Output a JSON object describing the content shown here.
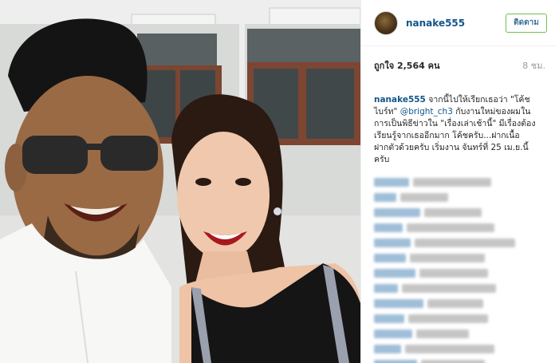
{
  "post": {
    "photo_alt": "photo",
    "author": {
      "username": "nanake555",
      "follow_label": "ติดตาม"
    },
    "likes_label": "ถูกใจ 2,564 คน",
    "age_label": "8 ชม.",
    "caption": {
      "username": "nanake555",
      "part1": " จากนี้ไปให้เรียกเธอว่า \"โค้ชไบร์ท\" ",
      "mention": "@bright_ch3",
      "part2": " กับงานใหม่ของผมในการเป็นพิธีข่าวใน \"เรื่องเล่าเช้านี้\" มีเรื่องต้องเรียนรู้จากเธออีกมาก โค้ชครับ...ฝากเนื้อฝากตัวด้วยครับ เริ่มงาน จันทร์ที่ 25 เม.ย.นี้ครับ"
    }
  },
  "colors": {
    "link_blue": "#125688",
    "follow_border": "#70c050",
    "follow_text": "#3f729b",
    "muted": "#999999"
  }
}
